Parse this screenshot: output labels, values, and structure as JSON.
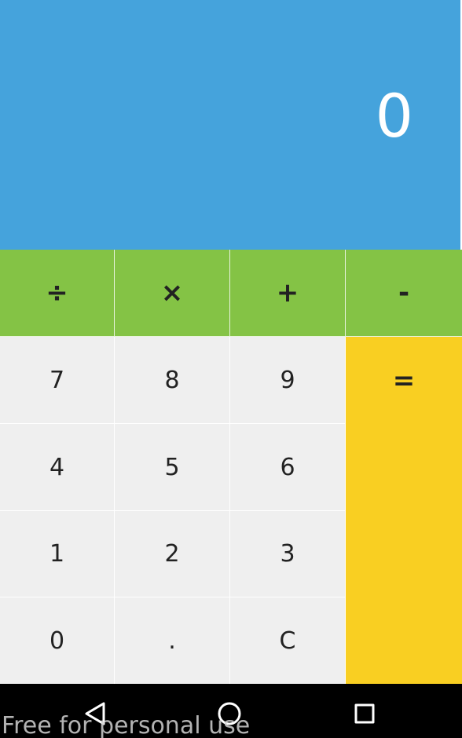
{
  "display": {
    "value": "0"
  },
  "operators": [
    {
      "label": "÷"
    },
    {
      "label": "×"
    },
    {
      "label": "+"
    },
    {
      "label": "-"
    }
  ],
  "keys": {
    "seven": "7",
    "eight": "8",
    "nine": "9",
    "four": "4",
    "five": "5",
    "six": "6",
    "one": "1",
    "two": "2",
    "three": "3",
    "zero": "0",
    "dot": ".",
    "clear": "C",
    "equals": "="
  },
  "nav": {
    "back_icon": "back-triangle-icon",
    "home_icon": "home-circle-icon",
    "recents_icon": "recents-square-icon"
  },
  "watermark": "Free for personal use",
  "colors": {
    "display_bg": "#45a3dc",
    "operator_bg": "#84c345",
    "number_bg": "#efefef",
    "equals_bg": "#f9cf22",
    "navbar_bg": "#000000"
  }
}
